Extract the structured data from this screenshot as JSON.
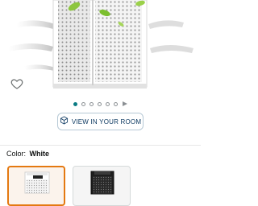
{
  "view_in_room": {
    "label": "VIEW IN YOUR ROOM",
    "icon": "cube-3d-icon"
  },
  "carousel": {
    "total_dots": 6,
    "active_index": 0,
    "has_video": true
  },
  "variation": {
    "label": "Color:",
    "selected": "White"
  },
  "swatches": [
    {
      "name": "White",
      "selected": true
    },
    {
      "name": "Black",
      "selected": false
    }
  ],
  "colors": {
    "accent": "#0a7b83",
    "selected_border": "#e47911",
    "link": "#0f3b63"
  }
}
